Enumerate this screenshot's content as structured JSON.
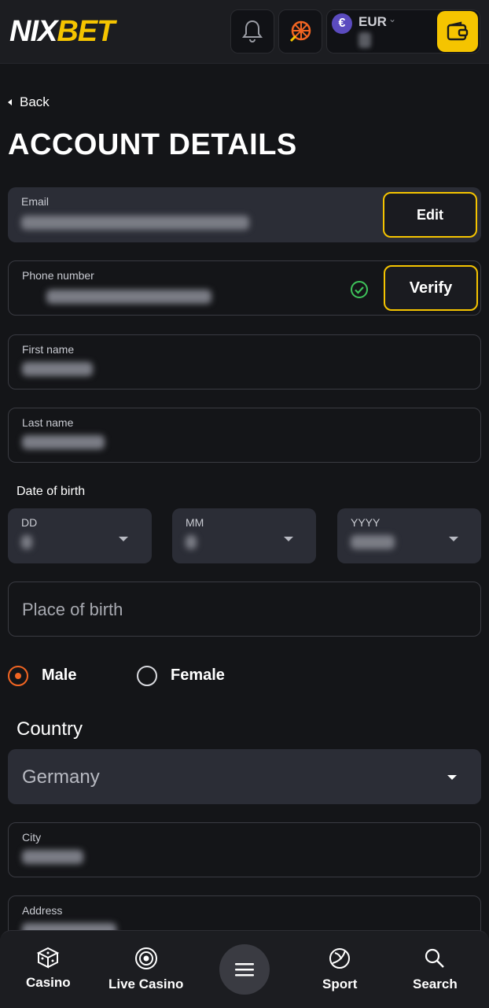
{
  "header": {
    "logo_main": "NIX",
    "logo_accent": "BET",
    "currency": "EUR",
    "currency_symbol": "€",
    "icons": [
      "bell-icon",
      "wheel-icon",
      "wallet-icon"
    ]
  },
  "nav": {
    "back_label": "Back"
  },
  "page": {
    "title": "ACCOUNT DETAILS"
  },
  "form": {
    "email": {
      "label": "Email",
      "button": "Edit"
    },
    "phone": {
      "label": "Phone number",
      "button": "Verify"
    },
    "first_name": {
      "label": "First name"
    },
    "last_name": {
      "label": "Last name"
    },
    "dob": {
      "label": "Date of birth",
      "day": "DD",
      "month": "MM",
      "year": "YYYY"
    },
    "place_of_birth": {
      "placeholder": "Place of birth"
    },
    "gender": {
      "male": "Male",
      "female": "Female",
      "selected": "Male"
    },
    "country": {
      "label": "Country",
      "value": "Germany"
    },
    "city": {
      "label": "City"
    },
    "address": {
      "label": "Address"
    }
  },
  "bottom_nav": {
    "casino": "Casino",
    "live_casino": "Live Casino",
    "sport": "Sport",
    "search": "Search"
  },
  "colors": {
    "accent": "#f5c400",
    "brand_orange": "#f26522",
    "verified": "#3ec35a"
  }
}
